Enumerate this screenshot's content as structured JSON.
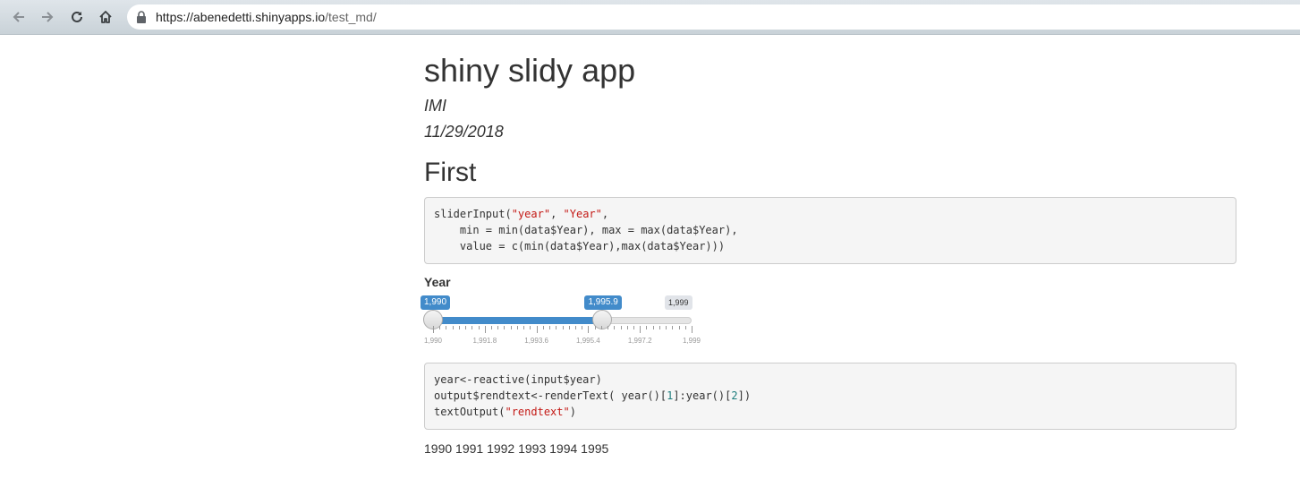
{
  "browser": {
    "url_host": "https://abenedetti.shinyapps.io",
    "url_path": "/test_md/"
  },
  "doc": {
    "title": "shiny slidy app",
    "author": "IMI",
    "date": "11/29/2018",
    "section_heading": "First"
  },
  "code_block_1": [
    [
      {
        "t": "sliderInput("
      },
      {
        "t": "\"year\"",
        "c": "str"
      },
      {
        "t": ", "
      },
      {
        "t": "\"Year\"",
        "c": "str"
      },
      {
        "t": ","
      }
    ],
    [
      {
        "t": "    min = min(data$Year), max = max(data$Year),"
      }
    ],
    [
      {
        "t": "    value = c(min(data$Year),max(data$Year)))"
      }
    ]
  ],
  "slider": {
    "label": "Year",
    "min": 1990,
    "max": 1999,
    "from": 1990,
    "to": 1995.9,
    "from_label": "1,990",
    "to_label": "1,995.9",
    "max_label": "1,999",
    "tick_labels": [
      "1,990",
      "1,991.8",
      "1,993.6",
      "1,995.4",
      "1,997.2",
      "1,999"
    ],
    "colors": {
      "accent": "#428bca"
    }
  },
  "code_block_2": [
    [
      {
        "t": "year<-reactive(input$year)"
      }
    ],
    [
      {
        "t": "output$rendtext<-renderText( year()["
      },
      {
        "t": "1",
        "c": "num"
      },
      {
        "t": "]:year()["
      },
      {
        "t": "2",
        "c": "num"
      },
      {
        "t": "])"
      }
    ],
    [
      {
        "t": "textOutput("
      },
      {
        "t": "\"rendtext\"",
        "c": "str"
      },
      {
        "t": ")"
      }
    ]
  ],
  "output_text": "1990 1991 1992 1993 1994 1995"
}
